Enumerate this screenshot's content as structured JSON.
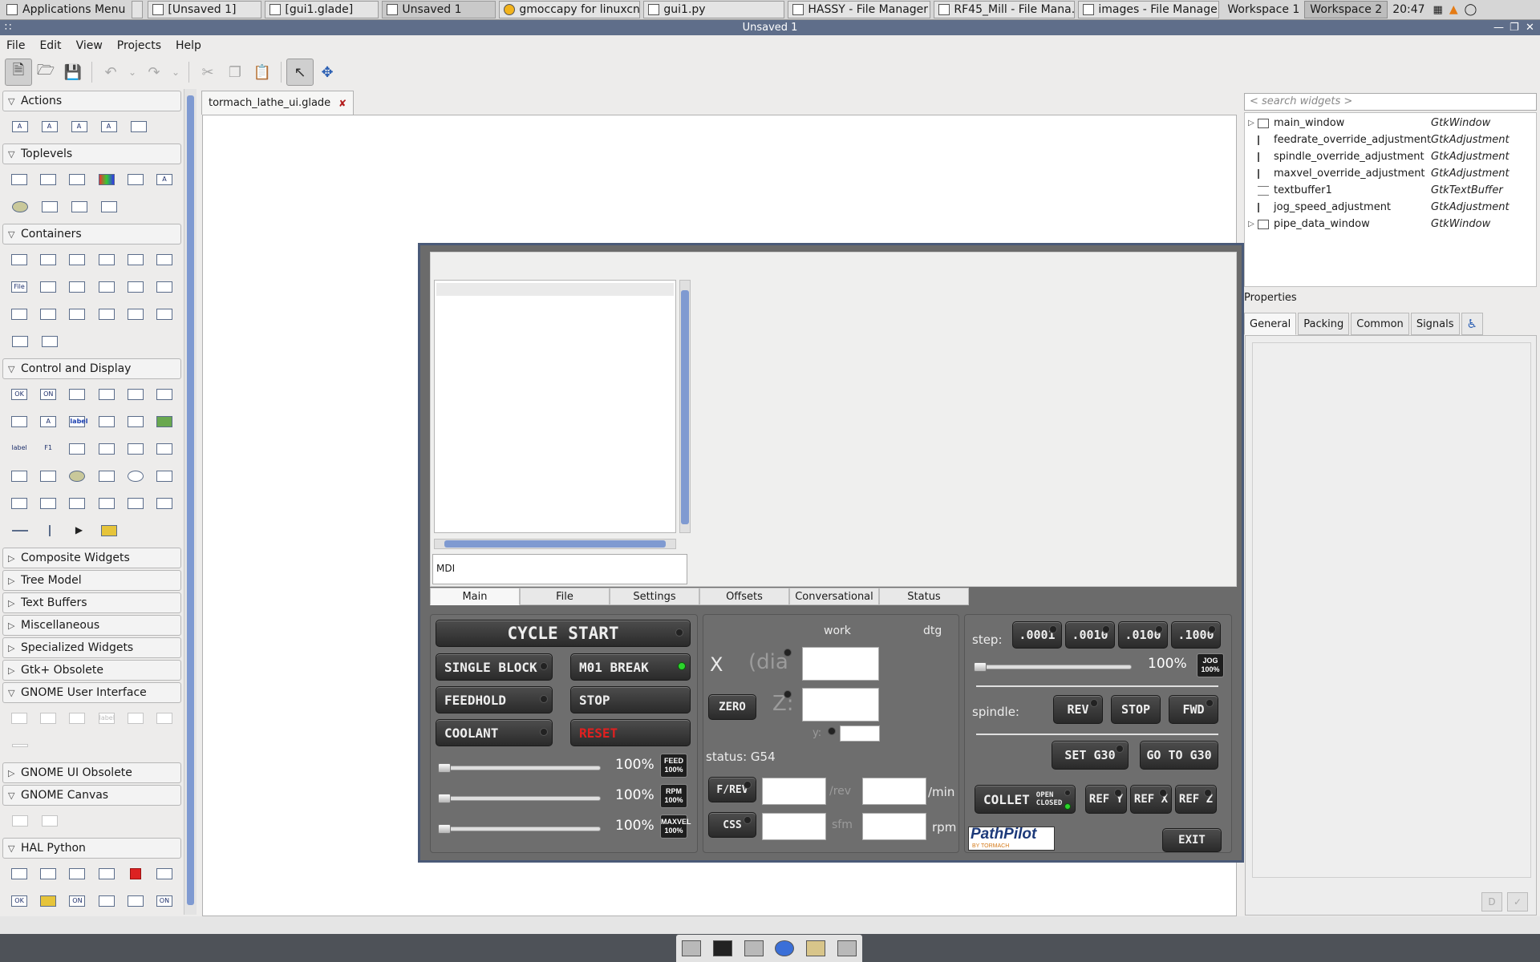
{
  "panel": {
    "app_menu": "Applications Menu",
    "tasks": [
      "[Unsaved 1]",
      "[gui1.glade]",
      "Unsaved 1",
      "gmoccapy for linuxcn...",
      "gui1.py",
      "HASSY - File Manager",
      "RF45_Mill - File Mana...",
      "images - File Manager"
    ],
    "workspaces": [
      "Workspace 1",
      "Workspace 2"
    ],
    "clock": "20:47"
  },
  "window": {
    "title": "Unsaved 1"
  },
  "menu": [
    "File",
    "Edit",
    "View",
    "Projects",
    "Help"
  ],
  "palette": {
    "groups": [
      "Actions",
      "Toplevels",
      "Containers",
      "Control and Display",
      "Composite Widgets",
      "Tree Model",
      "Text Buffers",
      "Miscellaneous",
      "Specialized Widgets",
      "Gtk+ Obsolete",
      "GNOME User Interface",
      "GNOME UI Obsolete",
      "GNOME Canvas",
      "HAL Python"
    ],
    "icon_texts": {
      "file": "File",
      "label": "label",
      "f1": "F1",
      "ok": "OK",
      "on": "ON",
      "a": "A"
    }
  },
  "document": {
    "tab": "tormach_lathe_ui.glade",
    "close": "✘"
  },
  "lathe": {
    "mdi": "MDI",
    "tabs": [
      "Main",
      "File",
      "Settings",
      "Offsets",
      "Conversational",
      "Status"
    ],
    "cycle_start": "CYCLE START",
    "single_block": "SINGLE BLOCK",
    "m01_break": "M01 BREAK",
    "feedhold": "FEEDHOLD",
    "stop": "STOP",
    "coolant": "COOLANT",
    "reset": "RESET",
    "pct": "100%",
    "feed_tag": "FEED 100%",
    "rpm_tag": "RPM 100%",
    "maxvel_tag": "MAXVEL 100%",
    "work": "work",
    "dtg": "dtg",
    "x_axis": "X",
    "dia": "(dia",
    "z_axis": "Z:",
    "y_axis": "y:",
    "zero": "ZERO",
    "status": "status: G54",
    "frev": "F/REV",
    "per_rev": "/rev",
    "per_min": "/min",
    "css": "CSS",
    "sfm": "sfm",
    "rpm": "rpm",
    "step_label": "step:",
    "steps": [
      ".0001",
      ".0010",
      ".0100",
      ".1000"
    ],
    "jog_pct": "100%",
    "jog_tag": "JOG 100%",
    "spindle_label": "spindle:",
    "rev": "REV",
    "sp_stop": "STOP",
    "fwd": "FWD",
    "set_g30": "SET G30",
    "goto_g30": "GO TO G30",
    "collet": "COLLET",
    "collet_open": "OPEN",
    "collet_closed": "CLOSED",
    "ref_y": "REF Y",
    "ref_x": "REF X",
    "ref_z": "REF Z",
    "logo": "PathPilot",
    "logo_sub": "BY TORMACH",
    "exit": "EXIT"
  },
  "inspector": {
    "search_placeholder": "< search widgets >",
    "tree": [
      {
        "name": "main_window",
        "type": "GtkWindow",
        "expander": "▷"
      },
      {
        "name": "feedrate_override_adjustment",
        "type": "GtkAdjustment",
        "expander": ""
      },
      {
        "name": "spindle_override_adjustment",
        "type": "GtkAdjustment",
        "expander": ""
      },
      {
        "name": "maxvel_override_adjustment",
        "type": "GtkAdjustment",
        "expander": ""
      },
      {
        "name": "textbuffer1",
        "type": "GtkTextBuffer",
        "expander": ""
      },
      {
        "name": "jog_speed_adjustment",
        "type": "GtkAdjustment",
        "expander": ""
      },
      {
        "name": "pipe_data_window",
        "type": "GtkWindow",
        "expander": "▷"
      }
    ],
    "properties_label": "Properties",
    "prop_tabs": [
      "General",
      "Packing",
      "Common",
      "Signals"
    ]
  },
  "colors": {
    "title_bar": "#5f6e8a",
    "scroll_thumb": "#7f9ad1",
    "led_on": "#2cd42c",
    "reset_text": "#e02020"
  }
}
